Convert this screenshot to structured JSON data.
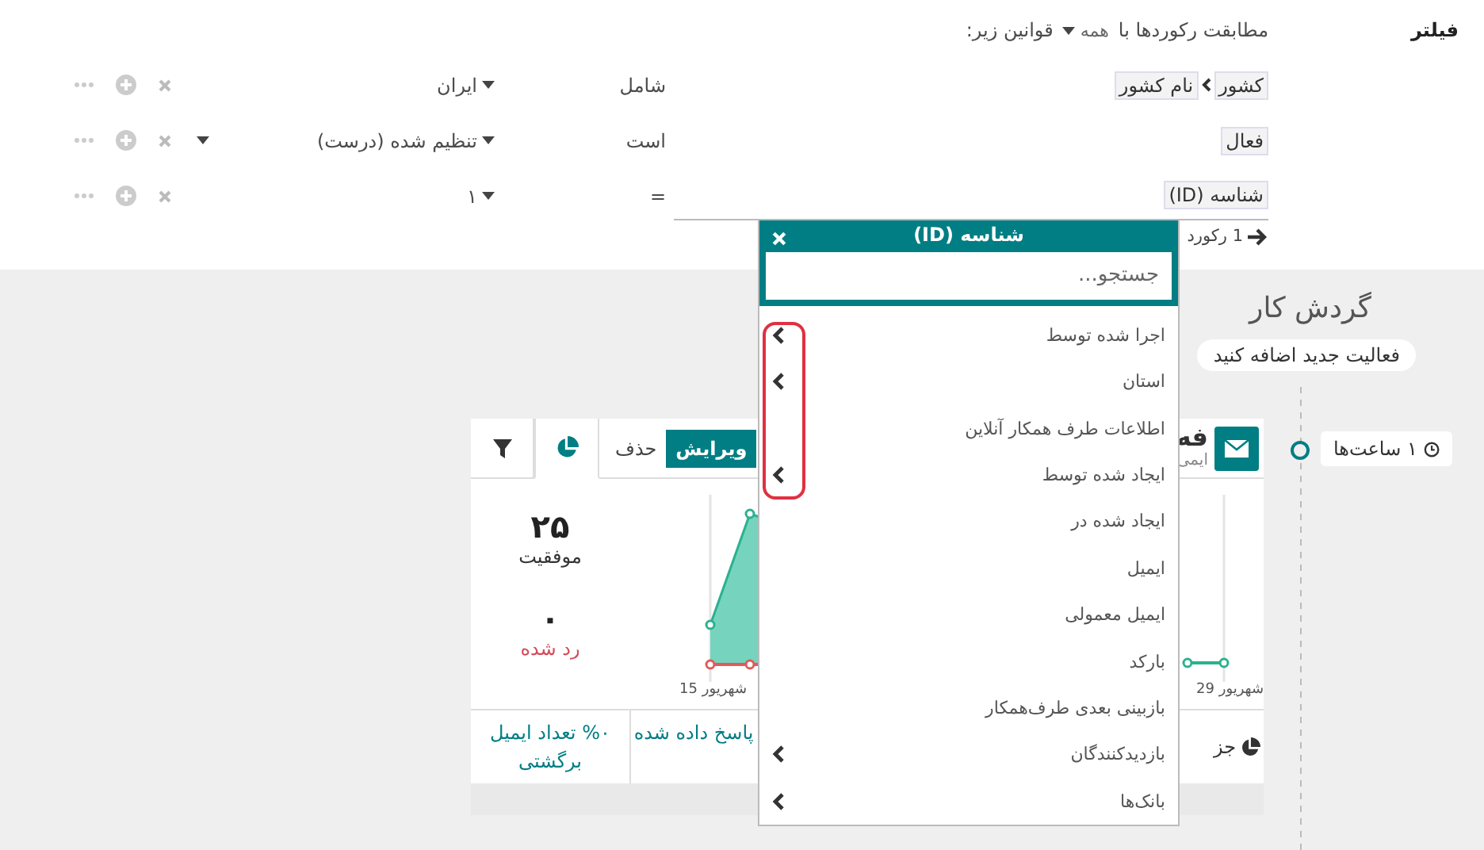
{
  "filter": {
    "label": "فیلتر",
    "match_prefix": "مطابقت رکوردها با",
    "match_mode": "همه",
    "match_suffix": "قوانین زیر:",
    "rules": [
      {
        "path": [
          "کشور",
          "نام کشور"
        ],
        "operator": "شامل",
        "value": "ایران",
        "kind": "text",
        "editing": false
      },
      {
        "path": [
          "فعال"
        ],
        "operator": "است",
        "value": "تنظیم شده (درست)",
        "kind": "boolean",
        "editing": false
      },
      {
        "path": [
          "شناسه (ID)"
        ],
        "operator": "=",
        "value": "۱",
        "kind": "text",
        "editing": true
      }
    ],
    "record_count": "1 رکورد"
  },
  "field_picker": {
    "title": "شناسه (ID)",
    "placeholder": "جستجو...",
    "items": [
      {
        "label": "اجرا شده توسط",
        "expandable": true
      },
      {
        "label": "استان",
        "expandable": true
      },
      {
        "label": "اطلاعات طرف همکار آنلاین",
        "expandable": false
      },
      {
        "label": "ایجاد شده توسط",
        "expandable": true
      },
      {
        "label": "ایجاد شده در",
        "expandable": false
      },
      {
        "label": "ایمیل",
        "expandable": false
      },
      {
        "label": "ایمیل معمولی",
        "expandable": false
      },
      {
        "label": "بارکد",
        "expandable": false
      },
      {
        "label": "بازبینی بعدی طرف‌همکار",
        "expandable": false
      },
      {
        "label": "بازدیدکنندگان",
        "expandable": true
      },
      {
        "label": "بانک‌ها",
        "expandable": true
      }
    ]
  },
  "workflow": {
    "title": "گردش کار",
    "add_button": "فعالیت جدید اضافه کنید",
    "trigger": "۱ ساعت‌ها",
    "activity": {
      "title": "فه",
      "subtitle": "ایمی",
      "edit_button": "ویرایش",
      "delete_button": "حذف",
      "tabs": [
        {
          "kind": "chart",
          "selected": true
        },
        {
          "kind": "filter",
          "selected": false
        }
      ],
      "stats": [
        {
          "value": "۲۵",
          "label": "موفقیت",
          "kind": "success"
        },
        {
          "value": "۰",
          "label": "رد شده",
          "kind": "rejected"
        }
      ],
      "dates": [
        "29 شهریور",
        "15 شهریور"
      ],
      "footer": [
        "جز",
        "پاسخ داده شده",
        "%۰ تعداد ایمیل برگشتی"
      ]
    }
  }
}
